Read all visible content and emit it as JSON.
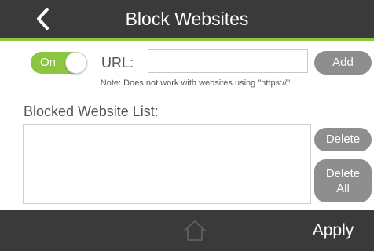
{
  "header": {
    "title": "Block Websites",
    "back_icon": "chevron-left-icon",
    "accent_color": "#8cc63f",
    "bar_color": "#3a3a3a"
  },
  "filter": {
    "toggle_label": "On",
    "toggle_state": "on",
    "url_label": "URL:",
    "url_value": "",
    "add_label": "Add",
    "note": "Note: Does not work with websites using \"https://\"."
  },
  "list": {
    "heading": "Blocked Website List:",
    "items": [],
    "delete_label": "Delete",
    "delete_all_line1": "Delete",
    "delete_all_line2": "All"
  },
  "footer": {
    "home_icon": "home-icon",
    "apply_label": "Apply"
  }
}
